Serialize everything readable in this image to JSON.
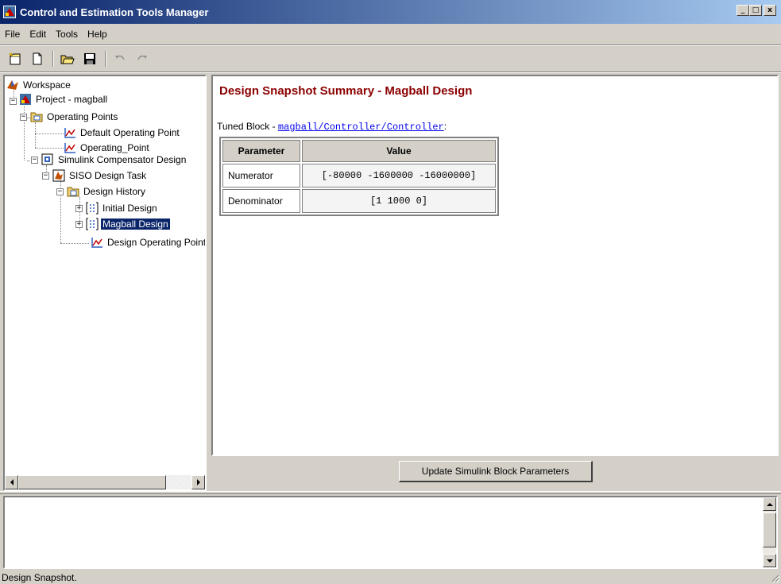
{
  "window": {
    "title": "Control and Estimation Tools Manager",
    "buttons": [
      "_",
      "□",
      "x"
    ]
  },
  "menu": [
    "File",
    "Edit",
    "Tools",
    "Help"
  ],
  "toolbar": {
    "icons": [
      "new-project-icon",
      "new-task-icon",
      "open-folder-icon",
      "save-icon",
      "undo-icon",
      "redo-icon"
    ]
  },
  "tree": {
    "nodes": [
      {
        "label": "Workspace",
        "icon": "matlab-icon"
      },
      {
        "label": "Project - magball",
        "icon": "project-icon"
      },
      {
        "label": "Operating Points",
        "icon": "folder-icon"
      },
      {
        "label": "Default Operating Point",
        "icon": "operating-point-icon"
      },
      {
        "label": "Operating_Point",
        "icon": "operating-point-icon"
      },
      {
        "label": "Simulink Compensator Design",
        "icon": "compensator-icon"
      },
      {
        "label": "SISO Design Task",
        "icon": "matlab-icon"
      },
      {
        "label": "Design History",
        "icon": "folder-icon"
      },
      {
        "label": "Initial Design",
        "icon": "design-icon"
      },
      {
        "label": "Magball Design",
        "icon": "design-icon",
        "selected": true
      },
      {
        "label": "Design Operating Point",
        "icon": "operating-point-icon"
      }
    ]
  },
  "content": {
    "heading": "Design Snapshot Summary - Magball Design",
    "tuned_prefix": "Tuned Block - ",
    "tuned_link": "magball/Controller/Controller",
    "tuned_suffix": ":",
    "table": {
      "headers": [
        "Parameter",
        "Value"
      ],
      "rows": [
        {
          "param": "Numerator",
          "value": "[-80000 -1600000 -16000000]"
        },
        {
          "param": "Denominator",
          "value": "[1 1000 0]"
        }
      ]
    },
    "update_button": "Update Simulink Block Parameters"
  },
  "status": {
    "text": "Design Snapshot."
  },
  "colors": {
    "title_gradient_start": "#0a246a",
    "title_gradient_end": "#a6caf0",
    "heading": "#8b0000",
    "selection": "#0a246a",
    "link": "#0000ee",
    "chrome": "#d4d0c8"
  }
}
